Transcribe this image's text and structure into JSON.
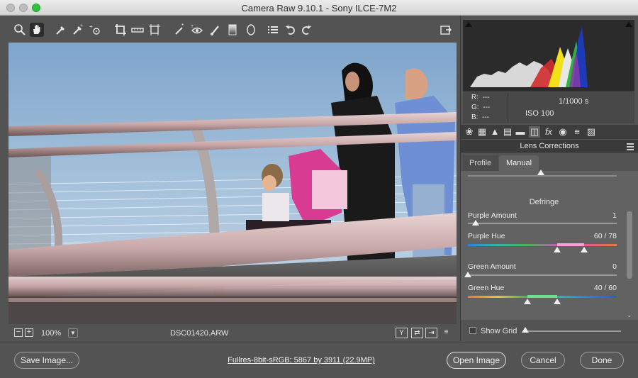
{
  "window": {
    "title": "Camera Raw 9.10.1  -  Sony ILCE-7M2"
  },
  "toolbar": {
    "tools": [
      "zoom-icon",
      "hand-icon",
      "white-balance-icon",
      "color-sampler-icon",
      "targeted-adjust-icon",
      "crop-icon",
      "straighten-icon",
      "transform-icon",
      "spot-removal-icon",
      "red-eye-icon",
      "adjustment-brush-icon",
      "graduated-filter-icon",
      "radial-filter-icon",
      "preferences-icon",
      "rotate-left-icon",
      "rotate-right-icon"
    ],
    "fullscreen_icon": "fullscreen-icon"
  },
  "viewer": {
    "zoom": "100%",
    "zoom_out": "−",
    "zoom_in": "+",
    "filename": "DSC01420.ARW",
    "icons": {
      "y": "Y",
      "swap": "⇄",
      "copy": "⇥",
      "settings": "≡"
    }
  },
  "readout": {
    "r_label": "R:",
    "r_value": "---",
    "g_label": "G:",
    "g_value": "---",
    "b_label": "B:",
    "b_value": "---",
    "shutter": "1/1000 s",
    "iso": "ISO 100"
  },
  "panel": {
    "section_title": "Lens Corrections",
    "tabs": {
      "profile": "Profile",
      "manual": "Manual"
    },
    "defringe": "Defringe",
    "purple_amount": {
      "label": "Purple Amount",
      "value": "1",
      "fraction": 0.05
    },
    "purple_hue": {
      "label": "Purple Hue",
      "value": "60 / 78",
      "low": 60,
      "high": 78,
      "max": 100
    },
    "green_amount": {
      "label": "Green Amount",
      "value": "0",
      "fraction": 0.0
    },
    "green_hue": {
      "label": "Green Hue",
      "value": "40 / 60",
      "low": 40,
      "high": 60,
      "max": 100
    },
    "show_grid": "Show Grid"
  },
  "bottom": {
    "save": "Save Image...",
    "workflow": "Fullres-8bit-sRGB; 5867 by 3911 (22.9MP)",
    "open": "Open Image",
    "cancel": "Cancel",
    "done": "Done"
  },
  "colors": {
    "purple_track": "#c05ab8",
    "green_track": "#2faa5c",
    "accent_max": "#2cc33f"
  }
}
